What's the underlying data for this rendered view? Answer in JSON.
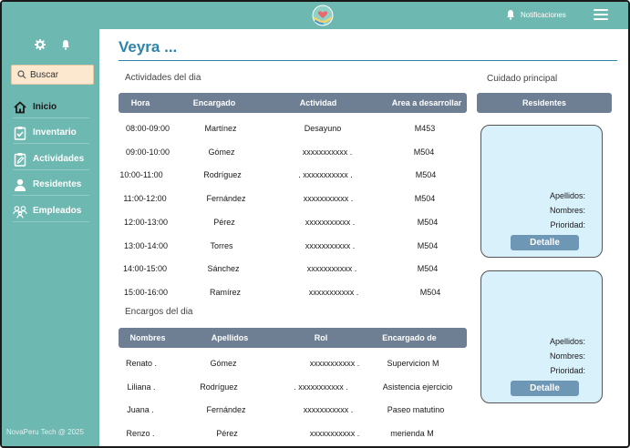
{
  "app": {
    "title": "Veyra ...",
    "footer": "NovaPeru Tech @ 2025"
  },
  "topbar": {
    "logo_icon": "hands-heart-logo",
    "notifications_label": "Notificaciones",
    "notifications_icon": "bell-icon",
    "menu_icon": "hamburger-icon"
  },
  "sidebar": {
    "top_icons": [
      "gear-icon",
      "bell-icon"
    ],
    "search_placeholder": "Buscar",
    "items": [
      {
        "label": "Inicio",
        "icon": "home-icon",
        "active": true
      },
      {
        "label": "Inventario",
        "icon": "clipboard-check-icon",
        "active": false
      },
      {
        "label": "Actividades",
        "icon": "clipboard-edit-icon",
        "active": false
      },
      {
        "label": "Residentes",
        "icon": "person-icon",
        "active": false
      },
      {
        "label": "Empleados",
        "icon": "group-icon",
        "active": false
      }
    ]
  },
  "activities": {
    "title": "Actividades del dia",
    "headers": [
      "Hora",
      "Encargado",
      "Actividad",
      "Area a desarrollar"
    ],
    "rows": [
      [
        "08:00-09:00",
        "Martínez",
        "Desayuno",
        "M453"
      ],
      [
        "09:00-10:00",
        "Gómez",
        "xxxxxxxxxxx .",
        "M504"
      ],
      [
        "10:00-11:00",
        "Rodríguez",
        ".    xxxxxxxxxxx .",
        "M504"
      ],
      [
        "11:00-12:00",
        "Fernández",
        "xxxxxxxxxxx .",
        "M504"
      ],
      [
        "12:00-13:00",
        "Pérez",
        "xxxxxxxxxxx .",
        "M504"
      ],
      [
        "13:00-14:00",
        "Torres",
        "xxxxxxxxxxx .",
        "M504"
      ],
      [
        "14:00-15:00",
        "Sánchez",
        "xxxxxxxxxxx .",
        "M504"
      ],
      [
        "15:00-16:00",
        "Ramírez",
        "xxxxxxxxxxx .",
        "M504"
      ]
    ]
  },
  "tasks": {
    "title": "Encargos del dia",
    "headers": [
      "Nombres",
      "Apellidos",
      "Rol",
      "Encargado de"
    ],
    "rows": [
      [
        "Renato .",
        "Gómez",
        "xxxxxxxxxxx .",
        "Supervicion M"
      ],
      [
        "Liliana .",
        "Rodríguez",
        ".    xxxxxxxxxxx .",
        "Asistencia ejercicio"
      ],
      [
        "Juana .",
        "Fernández",
        "xxxxxxxxxxx .",
        "Paseo matutino"
      ],
      [
        "Renzo .",
        "Pérez",
        "xxxxxxxxxxx .",
        "merienda M"
      ]
    ]
  },
  "care": {
    "title": "Cuidado principal",
    "header": "Residentes",
    "cards": [
      {
        "surname_label": "Apellidos:",
        "names_label": "Nombres:",
        "priority_label": "Prioridad:",
        "button": "Detalle"
      },
      {
        "surname_label": "Apellidos:",
        "names_label": "Nombres:",
        "priority_label": "Prioridad:",
        "button": "Detalle"
      }
    ]
  },
  "colors": {
    "teal": "#6db8b0",
    "header_gray": "#6e7f93",
    "title_blue": "#2e85a9",
    "card_bg": "#d8f1fb",
    "search_bg": "#fbe8cf"
  }
}
